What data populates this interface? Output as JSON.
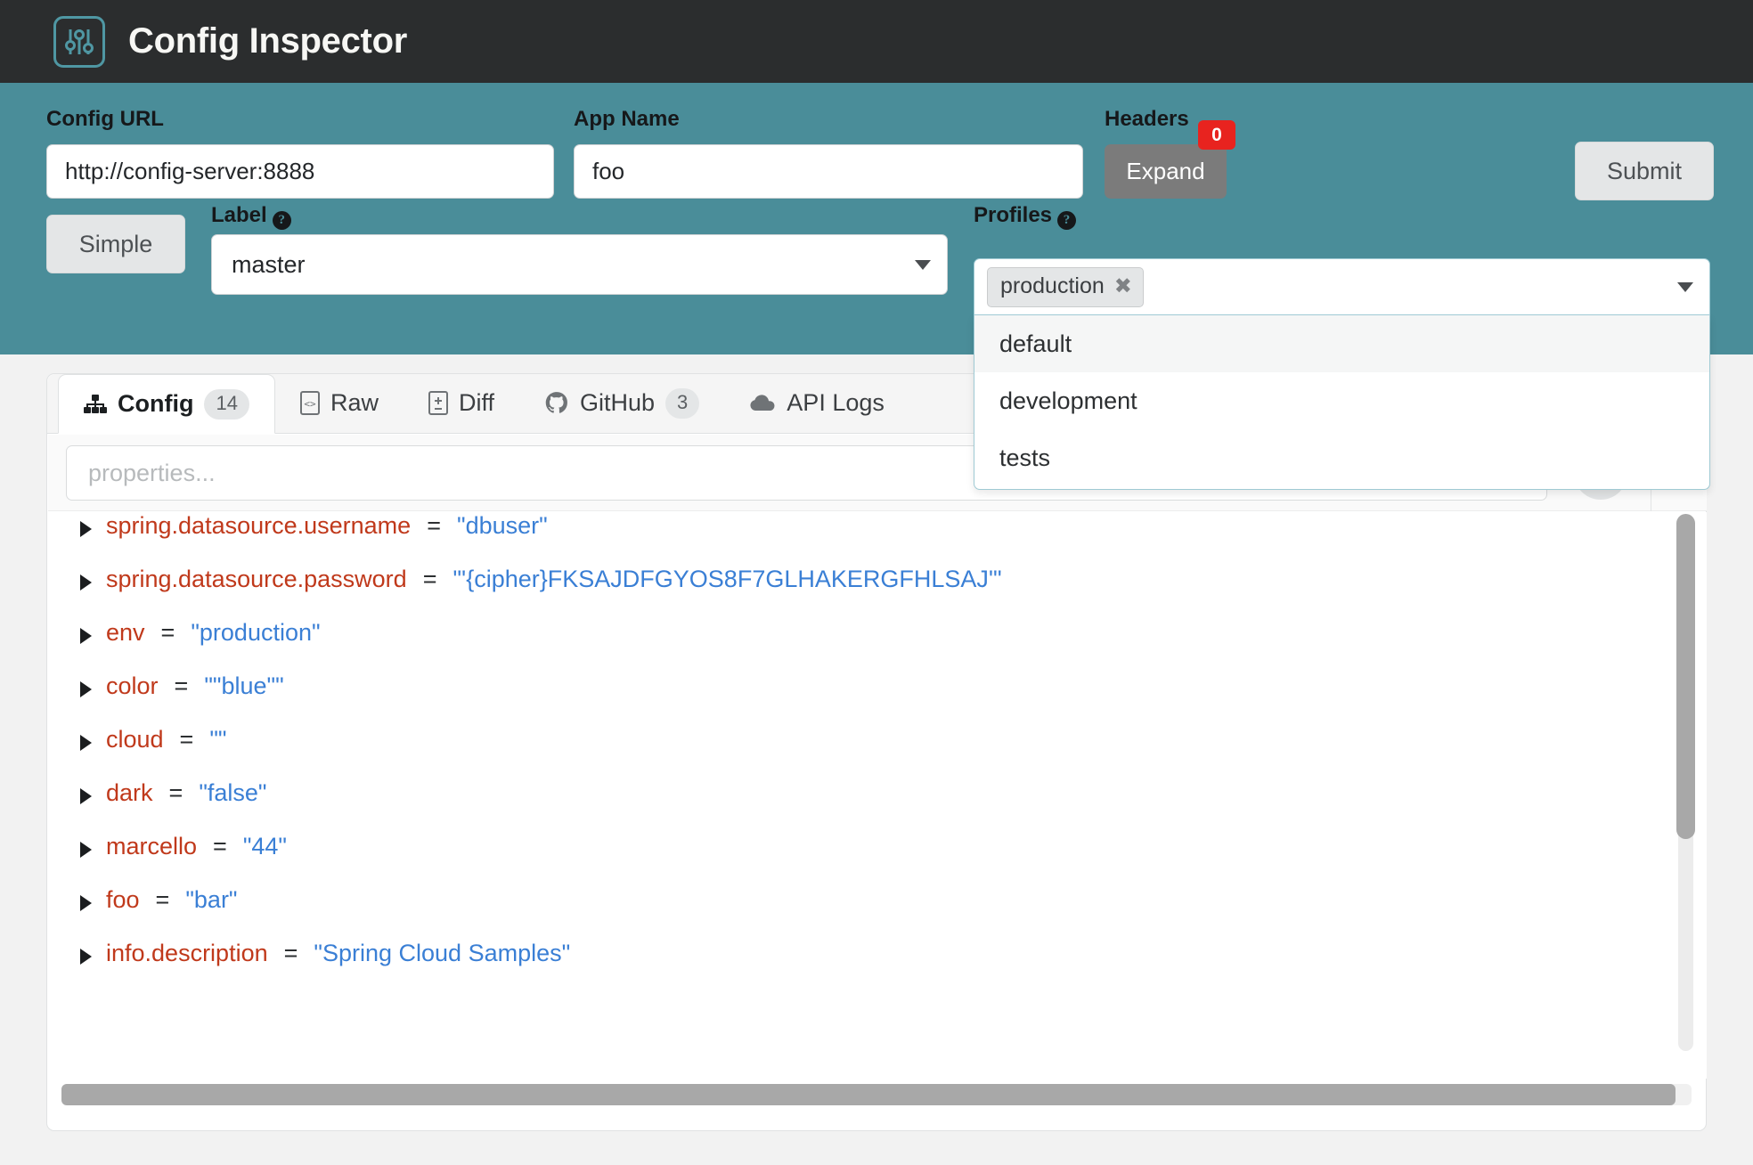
{
  "header": {
    "title": "Config Inspector",
    "logo_icon": "sliders-icon",
    "bg_color": "#2b2d2e",
    "accent_color": "#4f97a3"
  },
  "toolbar": {
    "bg_color": "#4a8d99",
    "config_url": {
      "label": "Config URL",
      "value": "http://config-server:8888"
    },
    "app_name": {
      "label": "App Name",
      "value": "foo"
    },
    "headers": {
      "label": "Headers",
      "button_label": "Expand",
      "count": "0",
      "badge_color": "#e8231f"
    },
    "submit_label": "Submit",
    "mode_toggle_label": "Simple",
    "label_field": {
      "label": "Label",
      "help_icon": "question-circle-icon",
      "value": "master"
    },
    "profiles_field": {
      "label": "Profiles",
      "help_icon": "question-circle-icon",
      "selected": [
        "production"
      ],
      "chip_remove_icon": "close-icon",
      "options": [
        {
          "label": "default",
          "active": true
        },
        {
          "label": "development",
          "active": false
        },
        {
          "label": "tests",
          "active": false
        }
      ]
    }
  },
  "main": {
    "tabs": [
      {
        "label": "Config",
        "icon": "sitemap-icon",
        "badge": "14",
        "active": true
      },
      {
        "label": "Raw",
        "icon": "code-file-icon",
        "badge": "",
        "active": false
      },
      {
        "label": "Diff",
        "icon": "file-diff-icon",
        "badge": "",
        "active": false
      },
      {
        "label": "GitHub",
        "icon": "github-icon",
        "badge": "3",
        "active": false
      },
      {
        "label": "API Logs",
        "icon": "cloud-icon",
        "badge": "",
        "active": false
      }
    ],
    "search": {
      "placeholder": "properties...",
      "value": "",
      "icon": "search-icon"
    },
    "decrypt_button": {
      "icon": "key-icon"
    },
    "properties": [
      {
        "key": "spring.datasource.username",
        "value": "\"dbuser\""
      },
      {
        "key": "spring.datasource.password",
        "value": "\"'{cipher}FKSAJDFGYOS8F7GLHAKERGFHLSAJ'\""
      },
      {
        "key": "env",
        "value": "\"production\""
      },
      {
        "key": "color",
        "value": "\"\"blue\"\""
      },
      {
        "key": "cloud",
        "value": "\"\""
      },
      {
        "key": "dark",
        "value": "\"false\""
      },
      {
        "key": "marcello",
        "value": "\"44\""
      },
      {
        "key": "foo",
        "value": "\"bar\""
      },
      {
        "key": "info.description",
        "value": "\"Spring Cloud Samples\""
      }
    ],
    "key_color": "#c0391b",
    "value_color": "#3a7fd5"
  }
}
